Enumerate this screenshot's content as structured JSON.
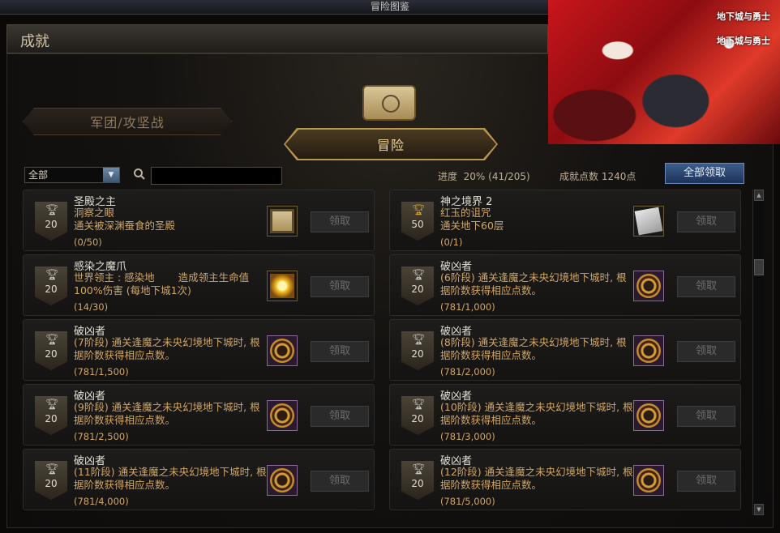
{
  "window": {
    "title": "冒险图鉴"
  },
  "header": {
    "title": "成就"
  },
  "banner": {
    "logo_text": "地下城与勇士"
  },
  "tabs": {
    "legion": "军团/攻坚战",
    "adventure": "冒险"
  },
  "toolbar": {
    "filter_selected": "全部",
    "search_placeholder": "",
    "progress_label": "进度",
    "progress_percent": "20%",
    "progress_count": "(41/205)",
    "points_label": "成就点数",
    "points_value": "1240点",
    "claim_all_label": "全部领取"
  },
  "achievements": [
    {
      "title": "圣殿之主",
      "desc": "洞察之眼\n通关被深渊蚕食的圣殿",
      "progress": "(0/50)",
      "points": "20",
      "medal": "silver",
      "reward_icon": "chest-icon",
      "claim_label": "领取"
    },
    {
      "title": "神之境界 2",
      "desc": "红玉的诅咒\n通关地下60层",
      "progress": "(0/1)",
      "points": "50",
      "medal": "gold",
      "reward_icon": "paper-icon",
      "claim_label": "领取"
    },
    {
      "title": "感染之魔爪",
      "desc": "世界领主 : 感染地　　 造成领主生命值100%伤害 (每地下城1次)",
      "progress": "(14/30)",
      "points": "20",
      "medal": "silver",
      "reward_icon": "spark-icon",
      "claim_label": "领取"
    },
    {
      "title": "破凶者",
      "desc": "(6阶段) 通关逢魔之未央幻境地下城时, 根据阶数获得相应点数。",
      "progress": "(781/1,000)",
      "points": "20",
      "medal": "silver",
      "reward_icon": "emblem-icon",
      "claim_label": "领取"
    },
    {
      "title": "破凶者",
      "desc": "(7阶段) 通关逢魔之未央幻境地下城时, 根据阶数获得相应点数。",
      "progress": "(781/1,500)",
      "points": "20",
      "medal": "silver",
      "reward_icon": "emblem-icon",
      "claim_label": "领取"
    },
    {
      "title": "破凶者",
      "desc": "(8阶段) 通关逢魔之未央幻境地下城时, 根据阶数获得相应点数。",
      "progress": "(781/2,000)",
      "points": "20",
      "medal": "silver",
      "reward_icon": "emblem-icon",
      "claim_label": "领取"
    },
    {
      "title": "破凶者",
      "desc": "(9阶段) 通关逢魔之未央幻境地下城时, 根据阶数获得相应点数。",
      "progress": "(781/2,500)",
      "points": "20",
      "medal": "silver",
      "reward_icon": "emblem-icon",
      "claim_label": "领取"
    },
    {
      "title": "破凶者",
      "desc": "(10阶段) 通关逢魔之未央幻境地下城时, 根据阶数获得相应点数。",
      "progress": "(781/3,000)",
      "points": "20",
      "medal": "silver",
      "reward_icon": "emblem-icon",
      "claim_label": "领取"
    },
    {
      "title": "破凶者",
      "desc": "(11阶段) 通关逢魔之未央幻境地下城时, 根据阶数获得相应点数。",
      "progress": "(781/4,000)",
      "points": "20",
      "medal": "silver",
      "reward_icon": "emblem-icon",
      "claim_label": "领取"
    },
    {
      "title": "破凶者",
      "desc": "(12阶段) 通关逢魔之未央幻境地下城时, 根据阶数获得相应点数。",
      "progress": "(781/5,000)",
      "points": "20",
      "medal": "silver",
      "reward_icon": "emblem-icon",
      "claim_label": "领取"
    }
  ],
  "colors": {
    "accent_gold": "#d0a766",
    "claim_all_blue": "#2d4a7a",
    "banner_red": "#c9161c"
  }
}
